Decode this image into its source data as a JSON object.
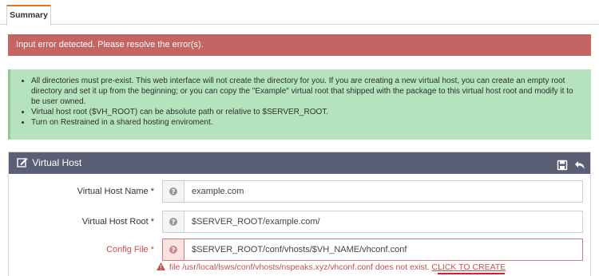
{
  "tabs": {
    "summary_label": "Summary"
  },
  "error_banner": {
    "text": "Input error detected. Please resolve the error(s)."
  },
  "info": {
    "items": [
      "All directories must pre-exist. This web interface will not create the directory for you. If you are creating a new virtual host, you can create an empty root directory and set it up from the beginning; or you can copy the \"Example\" virtual root that shipped with the package to this virtual host root and modify it to be user owned.",
      "Virtual host root ($VH_ROOT) can be absolute path or relative to $SERVER_ROOT.",
      "Turn on Restrained in a shared hosting enviroment."
    ]
  },
  "panel": {
    "title": "Virtual Host",
    "rows": [
      {
        "label": "Virtual Host Name *",
        "value": "example.com"
      },
      {
        "label": "Virtual Host Root *",
        "value": "$SERVER_ROOT/example.com/"
      },
      {
        "label": "Config File *",
        "value": "$SERVER_ROOT/conf/vhosts/$VH_NAME/vhconf.conf"
      }
    ],
    "error_text": "file /usr/local/lsws/conf/vhosts/nspeaks.xyz/vhconf.conf does not exist.",
    "create_link": "CLICK TO CREATE"
  },
  "colors": {
    "tab_accent": "#e8731a",
    "error_red": "#c46463",
    "info_green": "#b5e3bd",
    "header_slate": "#5a5f75"
  },
  "icons": [
    "edit-icon",
    "save-icon",
    "back-icon",
    "help-icon",
    "warning-icon"
  ]
}
